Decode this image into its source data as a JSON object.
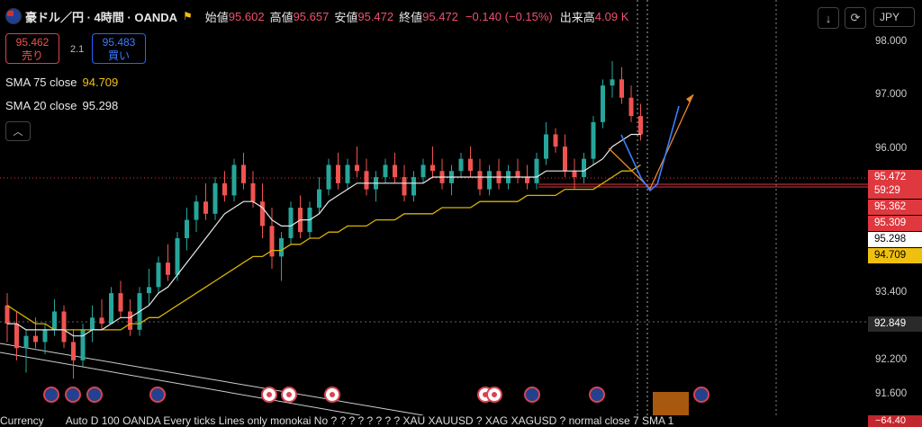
{
  "header": {
    "symbol": "豪ドル／円 · 4時間 · OANDA",
    "open_label": "始値",
    "open": "95.602",
    "high_label": "高値",
    "high": "95.657",
    "low_label": "安値",
    "low": "95.472",
    "close_label": "終値",
    "close": "95.472",
    "change": "−0.140 (−0.15%)",
    "volume_label": "出来高",
    "volume": "4.09 K",
    "currency": "JPY",
    "download_icon": "download-icon",
    "reset_icon": "reset-icon"
  },
  "trade": {
    "sell_price": "95.462",
    "sell_label": "売り",
    "spread": "2.1",
    "buy_price": "95.483",
    "buy_label": "買い"
  },
  "indicators": [
    {
      "name": "SMA 75 close",
      "value": "94.709",
      "color": "#f0c010"
    },
    {
      "name": "SMA 20 close",
      "value": "95.298",
      "color": "#e8e8e8"
    }
  ],
  "collapse_icon": "chevron-up-icon",
  "price_tags": [
    {
      "value": "95.472",
      "bg": "#e0383f",
      "fg": "#ffffff"
    },
    {
      "value": "59:29",
      "bg": "#e0383f",
      "fg": "#ffffff"
    },
    {
      "value": "95.362",
      "bg": "#e0383f",
      "fg": "#ffffff"
    },
    {
      "value": "95.309",
      "bg": "#e0383f",
      "fg": "#ffffff"
    },
    {
      "value": "95.298",
      "bg": "#ffffff",
      "fg": "#000000"
    },
    {
      "value": "94.709",
      "bg": "#f0c010",
      "fg": "#000000"
    },
    {
      "value": "92.849",
      "bg": "#2a2a2a",
      "fg": "#ffffff"
    }
  ],
  "bottom_bar": {
    "currency_label": "Currency",
    "text": "Auto D 100 OANDA Every ticks Lines only monokai No ? ? ? ? ? ? ? ? XAU XAUUSD ? XAG XAGUSD ? normal close 7 SMA 1",
    "right_value": "−64.40"
  },
  "events": [
    "au",
    "au",
    "au",
    "au",
    "jp",
    "jp",
    "jp",
    "jp",
    "jp",
    "au",
    "au",
    "au"
  ],
  "chart_data": {
    "type": "candlestick",
    "y_ticks": [
      "98.000",
      "97.000",
      "96.000",
      "93.400",
      "92.200",
      "91.600"
    ],
    "ylim": [
      91.4,
      98.2
    ],
    "candles": [
      [
        93.2,
        93.4,
        92.6,
        92.9
      ],
      [
        92.9,
        93.1,
        92.3,
        92.5
      ],
      [
        92.5,
        92.8,
        92.1,
        92.7
      ],
      [
        92.7,
        93.0,
        92.5,
        92.6
      ],
      [
        92.6,
        92.9,
        92.4,
        92.8
      ],
      [
        92.8,
        93.3,
        92.7,
        93.1
      ],
      [
        93.1,
        93.2,
        92.5,
        92.6
      ],
      [
        92.6,
        92.8,
        92.0,
        92.3
      ],
      [
        92.3,
        92.9,
        92.2,
        92.8
      ],
      [
        92.8,
        93.2,
        92.6,
        93.0
      ],
      [
        93.0,
        93.3,
        92.8,
        92.9
      ],
      [
        92.9,
        93.5,
        92.9,
        93.4
      ],
      [
        93.4,
        93.6,
        93.0,
        93.1
      ],
      [
        93.1,
        93.3,
        92.7,
        92.8
      ],
      [
        92.8,
        93.5,
        92.7,
        93.4
      ],
      [
        93.4,
        93.8,
        93.2,
        93.5
      ],
      [
        93.5,
        94.0,
        93.4,
        93.9
      ],
      [
        93.9,
        94.2,
        93.6,
        93.7
      ],
      [
        93.7,
        94.4,
        93.6,
        94.3
      ],
      [
        94.3,
        94.8,
        94.1,
        94.6
      ],
      [
        94.6,
        95.0,
        94.4,
        94.9
      ],
      [
        94.9,
        95.2,
        94.6,
        94.7
      ],
      [
        94.7,
        95.3,
        94.6,
        95.2
      ],
      [
        95.2,
        95.4,
        94.9,
        95.0
      ],
      [
        95.0,
        95.6,
        94.9,
        95.5
      ],
      [
        95.5,
        95.7,
        95.1,
        95.2
      ],
      [
        95.2,
        95.4,
        94.8,
        94.9
      ],
      [
        94.9,
        95.2,
        94.3,
        94.5
      ],
      [
        94.5,
        94.8,
        93.8,
        94.0
      ],
      [
        94.0,
        94.4,
        93.6,
        94.3
      ],
      [
        94.3,
        94.9,
        94.2,
        94.8
      ],
      [
        94.8,
        95.0,
        94.3,
        94.4
      ],
      [
        94.4,
        94.9,
        94.3,
        94.8
      ],
      [
        94.8,
        95.3,
        94.7,
        95.1
      ],
      [
        95.1,
        95.6,
        95.0,
        95.5
      ],
      [
        95.5,
        95.7,
        95.1,
        95.2
      ],
      [
        95.2,
        95.6,
        95.1,
        95.5
      ],
      [
        95.5,
        95.8,
        95.3,
        95.4
      ],
      [
        95.4,
        95.6,
        95.0,
        95.1
      ],
      [
        95.1,
        95.4,
        94.9,
        95.3
      ],
      [
        95.3,
        95.6,
        95.2,
        95.5
      ],
      [
        95.5,
        95.7,
        95.2,
        95.3
      ],
      [
        95.3,
        95.5,
        94.9,
        95.0
      ],
      [
        95.0,
        95.4,
        94.9,
        95.3
      ],
      [
        95.3,
        95.6,
        95.2,
        95.5
      ],
      [
        95.5,
        95.8,
        95.3,
        95.4
      ],
      [
        95.4,
        95.6,
        95.1,
        95.2
      ],
      [
        95.2,
        95.5,
        95.0,
        95.4
      ],
      [
        95.4,
        95.7,
        95.3,
        95.6
      ],
      [
        95.6,
        95.8,
        95.3,
        95.4
      ],
      [
        95.4,
        95.6,
        95.0,
        95.1
      ],
      [
        95.1,
        95.5,
        95.0,
        95.4
      ],
      [
        95.4,
        95.6,
        95.1,
        95.2
      ],
      [
        95.2,
        95.5,
        95.1,
        95.4
      ],
      [
        95.4,
        95.6,
        95.2,
        95.3
      ],
      [
        95.3,
        95.5,
        95.1,
        95.2
      ],
      [
        95.2,
        95.7,
        95.1,
        95.6
      ],
      [
        95.6,
        96.2,
        95.5,
        96.0
      ],
      [
        96.0,
        96.1,
        95.7,
        95.8
      ],
      [
        95.8,
        96.0,
        95.3,
        95.4
      ],
      [
        95.4,
        95.6,
        95.1,
        95.3
      ],
      [
        95.3,
        95.7,
        95.2,
        95.6
      ],
      [
        95.6,
        96.3,
        95.5,
        96.2
      ],
      [
        96.2,
        96.9,
        96.1,
        96.8
      ],
      [
        96.8,
        97.2,
        96.6,
        96.9
      ],
      [
        96.9,
        97.1,
        96.5,
        96.6
      ],
      [
        96.6,
        96.8,
        96.2,
        96.3
      ],
      [
        96.3,
        96.5,
        95.9,
        96.0
      ]
    ],
    "sma20": [
      92.9,
      92.9,
      92.8,
      92.8,
      92.8,
      92.8,
      92.8,
      92.7,
      92.7,
      92.8,
      92.8,
      92.9,
      93.0,
      93.0,
      93.1,
      93.2,
      93.4,
      93.5,
      93.7,
      93.9,
      94.1,
      94.3,
      94.5,
      94.7,
      94.8,
      94.9,
      94.9,
      94.8,
      94.6,
      94.5,
      94.5,
      94.6,
      94.6,
      94.7,
      94.9,
      95.0,
      95.1,
      95.2,
      95.2,
      95.2,
      95.2,
      95.2,
      95.2,
      95.2,
      95.2,
      95.3,
      95.3,
      95.3,
      95.3,
      95.3,
      95.3,
      95.3,
      95.3,
      95.3,
      95.3,
      95.3,
      95.3,
      95.4,
      95.4,
      95.4,
      95.4,
      95.4,
      95.5,
      95.6,
      95.8,
      95.9,
      96.0,
      96.0
    ],
    "sma75": [
      93.2,
      93.1,
      93.0,
      92.9,
      92.9,
      92.8,
      92.8,
      92.8,
      92.8,
      92.8,
      92.8,
      92.8,
      92.8,
      92.9,
      92.9,
      93.0,
      93.0,
      93.1,
      93.2,
      93.3,
      93.4,
      93.5,
      93.6,
      93.7,
      93.8,
      93.9,
      94.0,
      94.0,
      94.1,
      94.1,
      94.2,
      94.2,
      94.3,
      94.3,
      94.4,
      94.4,
      94.5,
      94.5,
      94.5,
      94.6,
      94.6,
      94.6,
      94.7,
      94.7,
      94.7,
      94.7,
      94.8,
      94.8,
      94.8,
      94.8,
      94.9,
      94.9,
      94.9,
      94.9,
      94.9,
      95.0,
      95.0,
      95.0,
      95.0,
      95.1,
      95.1,
      95.1,
      95.1,
      95.2,
      95.3,
      95.4,
      95.4,
      95.5
    ]
  }
}
